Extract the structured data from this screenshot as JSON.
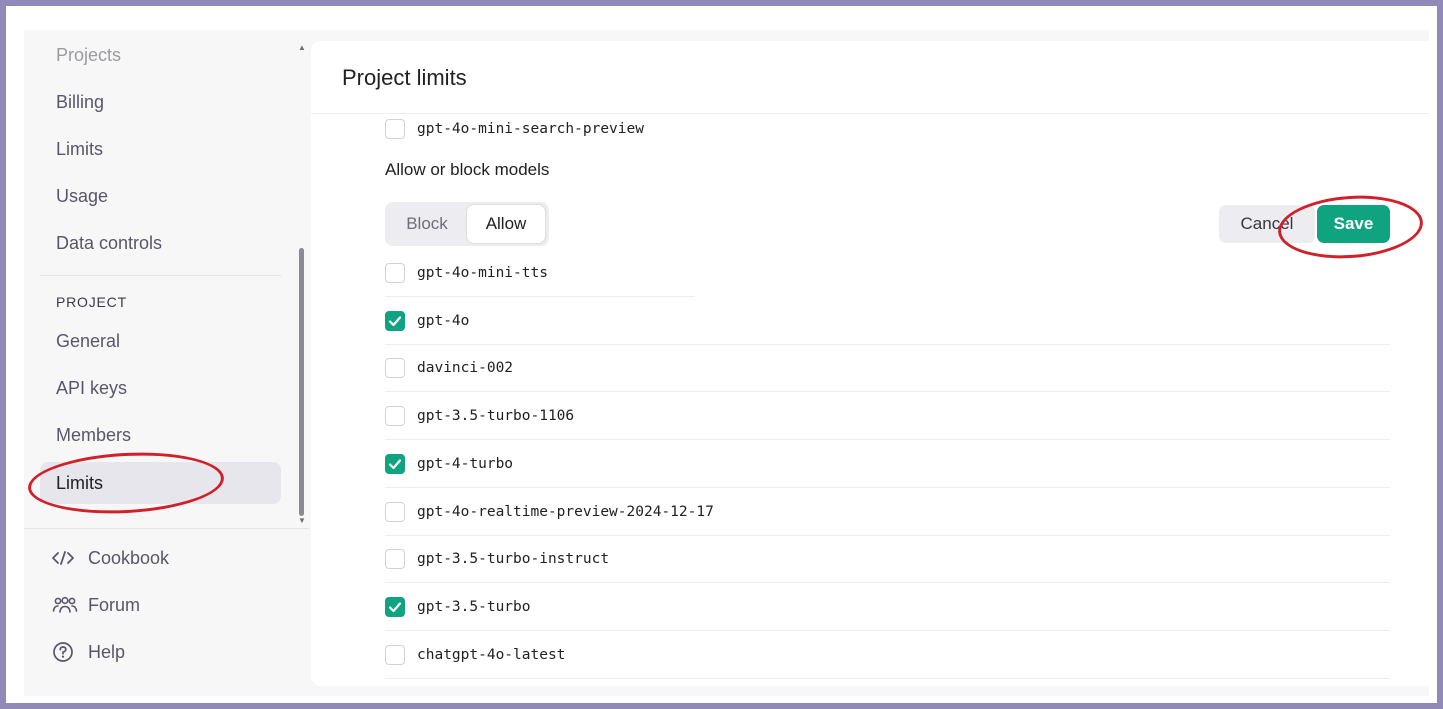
{
  "sidebar": {
    "org_items": [
      {
        "label": "Projects"
      },
      {
        "label": "Billing"
      },
      {
        "label": "Limits"
      },
      {
        "label": "Usage"
      },
      {
        "label": "Data controls"
      }
    ],
    "project_section_label": "PROJECT",
    "project_items": [
      {
        "label": "General"
      },
      {
        "label": "API keys"
      },
      {
        "label": "Members"
      },
      {
        "label": "Limits",
        "active": true
      }
    ],
    "footer": [
      {
        "label": "Cookbook",
        "icon": "code-icon"
      },
      {
        "label": "Forum",
        "icon": "people-icon"
      },
      {
        "label": "Help",
        "icon": "help-circle-icon"
      }
    ]
  },
  "main": {
    "title": "Project limits",
    "top_model": {
      "name": "gpt-4o-mini-search-preview",
      "checked": false
    },
    "allow_block_heading": "Allow or block models",
    "segment": {
      "block_label": "Block",
      "allow_label": "Allow",
      "selected": "Allow"
    },
    "actions": {
      "cancel_label": "Cancel",
      "save_label": "Save"
    },
    "models": [
      {
        "name": "gpt-4o-mini-tts",
        "checked": false
      },
      {
        "name": "gpt-4o",
        "checked": true
      },
      {
        "name": "davinci-002",
        "checked": false
      },
      {
        "name": "gpt-3.5-turbo-1106",
        "checked": false
      },
      {
        "name": "gpt-4-turbo",
        "checked": true
      },
      {
        "name": "gpt-4o-realtime-preview-2024-12-17",
        "checked": false
      },
      {
        "name": "gpt-3.5-turbo-instruct",
        "checked": false
      },
      {
        "name": "gpt-3.5-turbo",
        "checked": true
      },
      {
        "name": "chatgpt-4o-latest",
        "checked": false
      }
    ]
  },
  "colors": {
    "accent": "#10a37f",
    "annotation": "#d0202a",
    "frame": "#9189b8"
  }
}
